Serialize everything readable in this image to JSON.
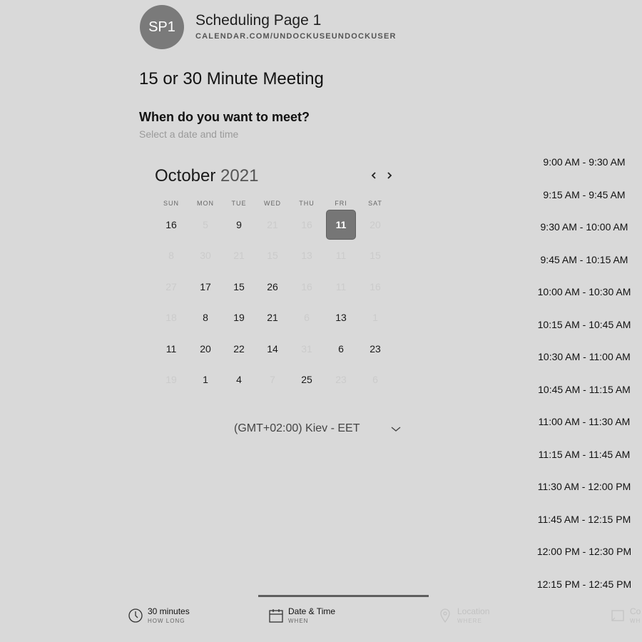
{
  "header": {
    "avatar_initials": "SP1",
    "page_name": "Scheduling Page 1",
    "page_url": "CALENDAR.COM/UNDOCKUSEUNDOCKUSER"
  },
  "meeting_title": "15 or 30 Minute Meeting",
  "when": {
    "question": "When do you want to meet?",
    "subtitle": "Select a date and time"
  },
  "calendar": {
    "month": "October",
    "year": "2021",
    "weekdays": [
      "SUN",
      "MON",
      "TUE",
      "WED",
      "THU",
      "FRI",
      "SAT"
    ],
    "weeks": [
      [
        {
          "d": "16",
          "on": true
        },
        {
          "d": "5",
          "on": false
        },
        {
          "d": "9",
          "on": true
        },
        {
          "d": "21",
          "on": false
        },
        {
          "d": "16",
          "on": false
        },
        {
          "d": "11",
          "on": true,
          "selected": true
        },
        {
          "d": "20",
          "on": false
        }
      ],
      [
        {
          "d": "8",
          "on": false
        },
        {
          "d": "30",
          "on": false
        },
        {
          "d": "21",
          "on": false
        },
        {
          "d": "15",
          "on": false
        },
        {
          "d": "13",
          "on": false
        },
        {
          "d": "11",
          "on": false
        },
        {
          "d": "15",
          "on": false
        }
      ],
      [
        {
          "d": "27",
          "on": false
        },
        {
          "d": "17",
          "on": true
        },
        {
          "d": "15",
          "on": true
        },
        {
          "d": "26",
          "on": true
        },
        {
          "d": "16",
          "on": false
        },
        {
          "d": "11",
          "on": false
        },
        {
          "d": "16",
          "on": false
        }
      ],
      [
        {
          "d": "18",
          "on": false
        },
        {
          "d": "8",
          "on": true
        },
        {
          "d": "19",
          "on": true
        },
        {
          "d": "21",
          "on": true
        },
        {
          "d": "6",
          "on": false
        },
        {
          "d": "13",
          "on": true
        },
        {
          "d": "1",
          "on": false
        }
      ],
      [
        {
          "d": "11",
          "on": true
        },
        {
          "d": "20",
          "on": true
        },
        {
          "d": "22",
          "on": true
        },
        {
          "d": "14",
          "on": true
        },
        {
          "d": "31",
          "on": false
        },
        {
          "d": "6",
          "on": true
        },
        {
          "d": "23",
          "on": true
        }
      ],
      [
        {
          "d": "19",
          "on": false
        },
        {
          "d": "1",
          "on": true
        },
        {
          "d": "4",
          "on": true
        },
        {
          "d": "7",
          "on": false
        },
        {
          "d": "25",
          "on": true
        },
        {
          "d": "23",
          "on": false
        },
        {
          "d": "6",
          "on": false
        }
      ]
    ],
    "prev_icon": "chevron-left-icon",
    "next_icon": "chevron-right-icon"
  },
  "timezone": {
    "label": "(GMT+02:00) Kiev - EET",
    "icon": "chevron-down-icon"
  },
  "time_slots": [
    "9:00 AM - 9:30 AM",
    "9:15 AM - 9:45 AM",
    "9:30 AM - 10:00 AM",
    "9:45 AM - 10:15 AM",
    "10:00 AM - 10:30 AM",
    "10:15 AM - 10:45 AM",
    "10:30 AM - 11:00 AM",
    "10:45 AM - 11:15 AM",
    "11:00 AM - 11:30 AM",
    "11:15 AM - 11:45 AM",
    "11:30 AM - 12:00 PM",
    "11:45 AM - 12:15 PM",
    "12:00 PM - 12:30 PM",
    "12:15 PM - 12:45 PM"
  ],
  "steps": [
    {
      "title": "30 minutes",
      "sub": "HOW LONG",
      "icon": "clock-icon",
      "active": false,
      "dim": false
    },
    {
      "title": "Date & Time",
      "sub": "WHEN",
      "icon": "calendar-icon",
      "active": true,
      "dim": false
    },
    {
      "title": "Location",
      "sub": "WHERE",
      "icon": "location-pin-icon",
      "active": false,
      "dim": true
    },
    {
      "title": "Co",
      "sub": "WH",
      "icon": "contact-icon",
      "active": false,
      "dim": true
    }
  ],
  "colors": {
    "background": "#d9d9d9",
    "selected_day": "#767676",
    "active_step_bar": "#5e5e5e"
  }
}
